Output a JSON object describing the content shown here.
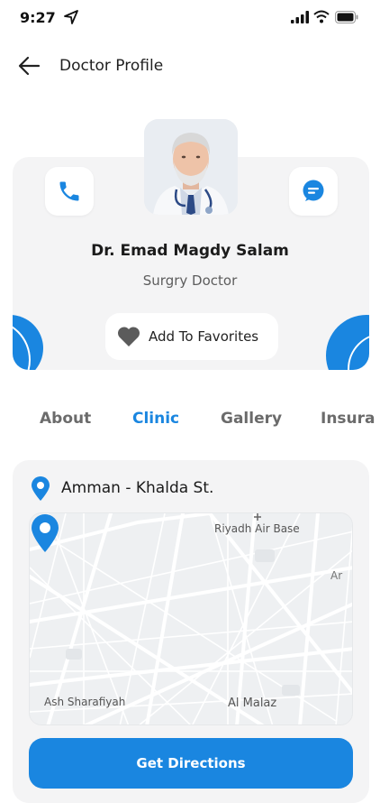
{
  "status_bar": {
    "time": "9:27",
    "icons": [
      "location-arrow-icon",
      "signal-icon",
      "wifi-icon",
      "battery-icon"
    ]
  },
  "header": {
    "back_icon": "arrow-left-icon",
    "title": "Doctor Profile"
  },
  "profile": {
    "name": "Dr. Emad Magdy Salam",
    "specialty": "Surgry Doctor",
    "call_icon": "phone-icon",
    "chat_icon": "chat-icon",
    "favorite_icon": "heart-icon",
    "favorite_label": "Add To Favorites"
  },
  "tabs": [
    {
      "label": "About",
      "active": false
    },
    {
      "label": "Clinic",
      "active": true
    },
    {
      "label": "Gallery",
      "active": false
    },
    {
      "label": "Insura",
      "active": false
    }
  ],
  "clinic": {
    "location_icon": "map-pin-icon",
    "location": "Amman - Khalda St.",
    "map_labels": {
      "riyadh": "Riyadh Air Base",
      "ar": "Ar",
      "ash": "Ash Sharafiyah",
      "malaz": "Al Malaz"
    },
    "directions_label": "Get Directions"
  },
  "colors": {
    "accent": "#1a86e0",
    "card_bg": "#f4f4f5",
    "text": "#1b1b1b",
    "muted": "#5d5d5d"
  }
}
